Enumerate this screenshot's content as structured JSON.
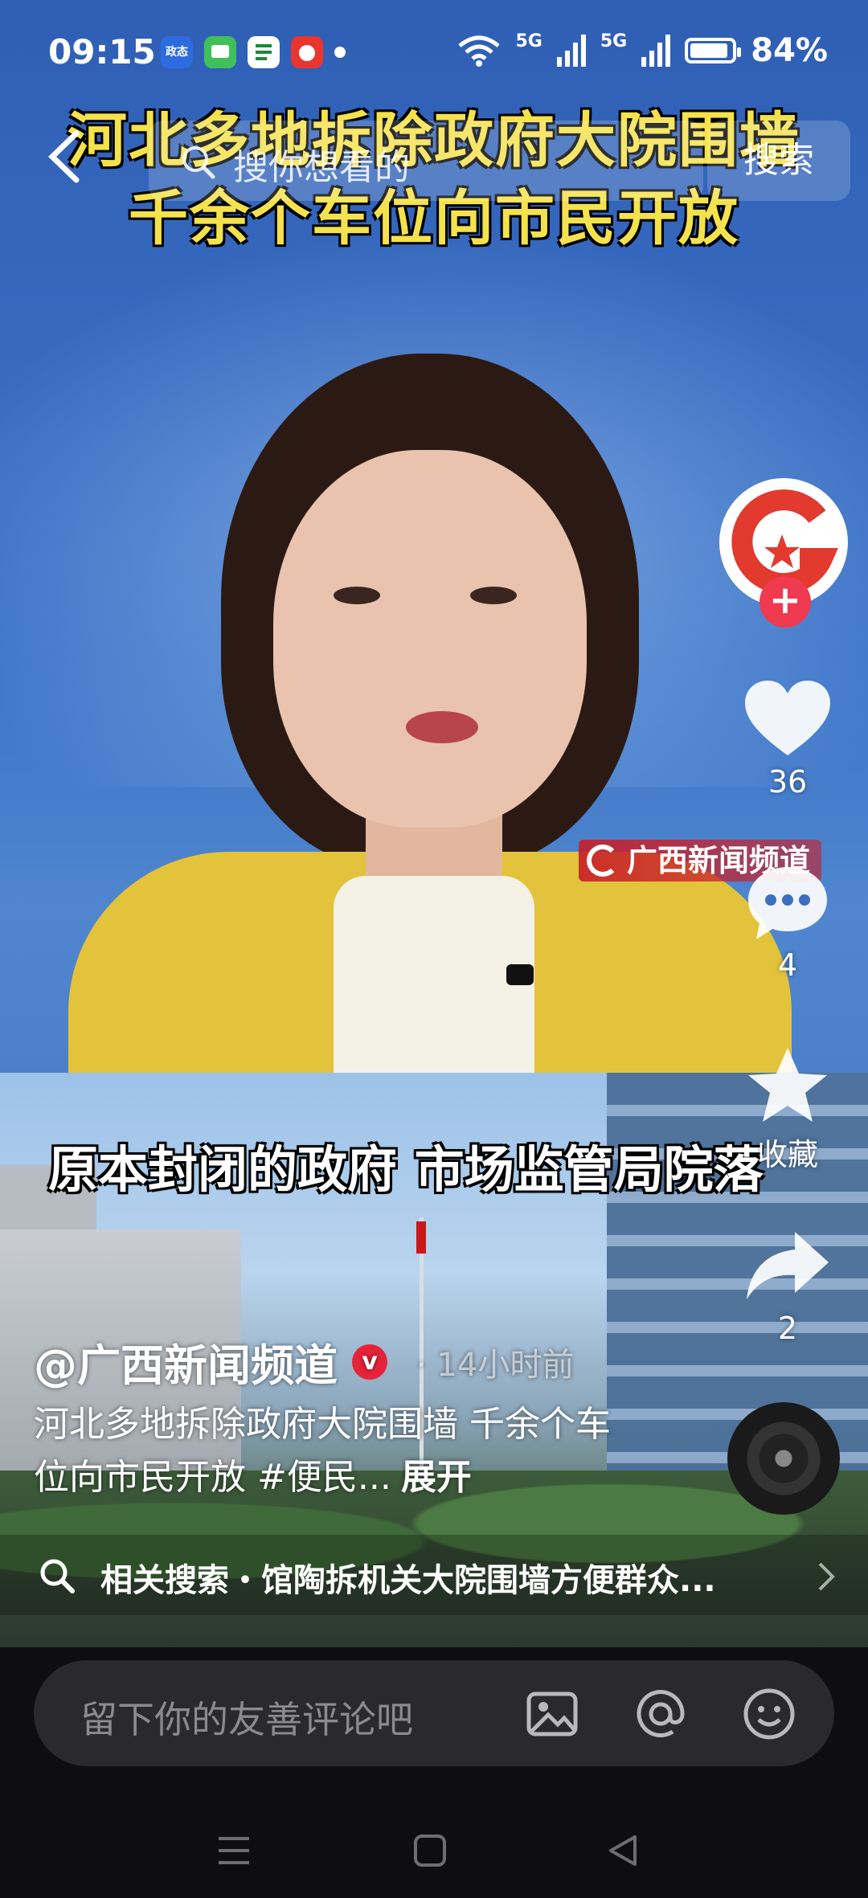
{
  "status_bar": {
    "time": "09:15",
    "app_icons": [
      "app-icon-1",
      "message-icon",
      "post-icon",
      "app-icon-2"
    ],
    "app_icon_1_text": "政态",
    "signal_1": "5G",
    "signal_2": "5G",
    "battery": "84%"
  },
  "search": {
    "placeholder": "搜你想看的",
    "button_label": "搜索"
  },
  "video": {
    "headline_line1": "河北多地拆除政府大院围墙",
    "headline_line2": "千余个车位向市民开放",
    "subtitle": "原本封闭的政府 市场监管局院落",
    "station_logo": "广西新闻频道"
  },
  "rail": {
    "follow_label": "+",
    "like_count": "36",
    "comment_count": "4",
    "favorite_label": "收藏",
    "share_count": "2"
  },
  "caption": {
    "author": "@广西新闻频道",
    "verified_label": "v",
    "time_ago": "· 14小时前",
    "description": "河北多地拆除政府大院围墙 千余个车位向市民开放 #便民...",
    "expand_label": "展开"
  },
  "related": {
    "text": "相关搜索・馆陶拆机关大院围墙方便群众..."
  },
  "comment_bar": {
    "placeholder": "留下你的友善评论吧"
  },
  "colors": {
    "headline": "#f4e24c",
    "accent_red": "#f03a4f",
    "background": "#111111"
  }
}
